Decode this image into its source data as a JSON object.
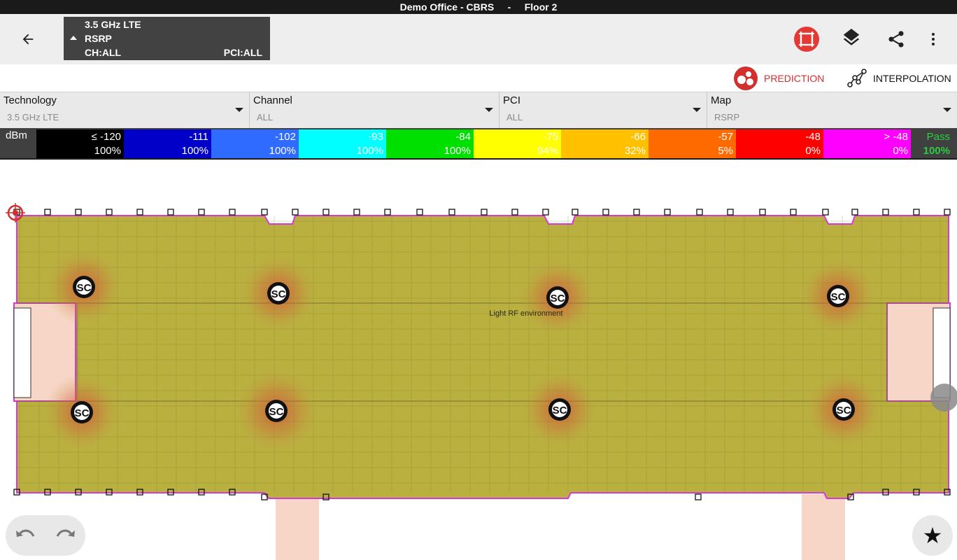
{
  "window_title": "Demo Office - CBRS     -     Floor 2",
  "info": {
    "tech": "3.5 GHz LTE",
    "metric": "RSRP",
    "channel": "CH:ALL",
    "pci": "PCI:ALL"
  },
  "actions": [
    "area-select-icon",
    "layers-icon",
    "share-icon",
    "more-vert-icon"
  ],
  "modes": {
    "prediction": "PREDICTION",
    "interpolation": "INTERPOLATION",
    "active_color": "#d32f2f"
  },
  "filters": [
    {
      "label": "Technology",
      "value": "3.5 GHz LTE"
    },
    {
      "label": "Channel",
      "value": "ALL"
    },
    {
      "label": "PCI",
      "value": "ALL"
    },
    {
      "label": "Map",
      "value": "RSRP"
    }
  ],
  "legend": {
    "unit": "dBm",
    "bins": [
      {
        "value": "≤ -120",
        "pct": "100%",
        "color": "#000000",
        "text": "#ffffff"
      },
      {
        "value": "-111",
        "pct": "100%",
        "color": "#0000c8",
        "text": "#ffffff"
      },
      {
        "value": "-102",
        "pct": "100%",
        "color": "#2f6bff",
        "text": "#ffffff"
      },
      {
        "value": "-93",
        "pct": "100%",
        "color": "#00ffff",
        "text": "#ffffff"
      },
      {
        "value": "-84",
        "pct": "100%",
        "color": "#00e000",
        "text": "#ffffff"
      },
      {
        "value": "-75",
        "pct": "94%",
        "color": "#ffff00",
        "text": "#ffffff"
      },
      {
        "value": "-66",
        "pct": "32%",
        "color": "#ffc000",
        "text": "#ffffff"
      },
      {
        "value": "-57",
        "pct": "5%",
        "color": "#ff6a00",
        "text": "#ffffff"
      },
      {
        "value": "-48",
        "pct": "0%",
        "color": "#ff0000",
        "text": "#ffffff"
      },
      {
        "value": "> -48",
        "pct": "0%",
        "color": "#ff00ff",
        "text": "#ffffff"
      }
    ],
    "pass_label": "Pass",
    "pass_pct": "100%"
  },
  "map": {
    "note": "Light RF environment",
    "marker_label": "SC",
    "heat_color": "#b5ad33"
  }
}
